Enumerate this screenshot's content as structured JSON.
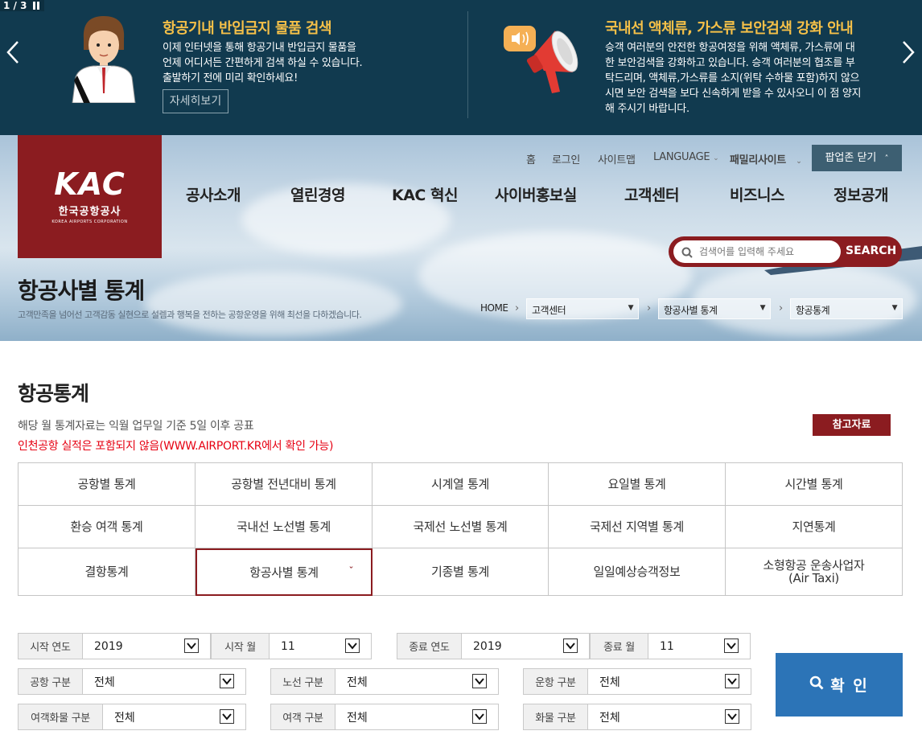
{
  "popup": {
    "counter": "1 / 3",
    "item1": {
      "title": "항공기내 반입금지 물품 검색",
      "line1": "이제 인터넷을 통해 항공기내 반입금지 물품을",
      "line2": "언제 어디서든 간편하게 검색 하실 수 있습니다.",
      "line3": "출발하기 전에 미리 확인하세요!",
      "button": "자세히보기"
    },
    "item2": {
      "title": "국내선 액체류, 가스류 보안검색 강화 안내",
      "line1": "승객 여러분의 안전한 항공여정을 위해 액체류, 가스류에 대",
      "line2": "한 보안검색을 강화하고 있습니다. 승객 여러분의 협조를 부",
      "line3": "탁드리며, 액체류,가스류를 소지(위탁 수하물 포함)하지 않으",
      "line4": "시면 보안 검색을 보다 신속하게 받을 수 있사오니 이 점 양지",
      "line5": "해 주시기 바랍니다."
    }
  },
  "header": {
    "logo": {
      "main": "KAC",
      "kr": "한국공항공사",
      "en": "KOREA AIRPORTS CORPORATION"
    },
    "util": {
      "home": "홈",
      "login": "로그인",
      "sitemap": "사이트맵",
      "language": "LANGUAGE",
      "family": "패밀리사이트",
      "popup_close": "팝업존 닫기"
    },
    "gnb": [
      "공사소개",
      "열린경영",
      "KAC 혁신",
      "사이버홍보실",
      "고객센터",
      "비즈니스",
      "정보공개"
    ],
    "search": {
      "placeholder": "검색어를 입력해 주세요",
      "button": "SEARCH"
    },
    "page_title": "항공사별 통계",
    "page_sub": "고객만족을 넘어선 고객감동 실현으로 설렘과 행복을 전하는 공항운영을 위해 최선을 다하겠습니다.",
    "breadcrumb": {
      "home": "HOME",
      "level1": "고객센터",
      "level2": "항공사별 통계",
      "level3": "항공통계"
    }
  },
  "content": {
    "title": "항공통계",
    "note1": "해당 월 통계자료는 익월 업무일 기준 5일 이후 공표",
    "note2": "인천공항 실적은 포함되지 않음(WWW.AIRPORT.KR에서 확인 가능)",
    "ref_button": "참고자료",
    "menu": [
      [
        "공항별 통계",
        "공항별 전년대비 통계",
        "시계열 통계",
        "요일별 통계",
        "시간별 통계"
      ],
      [
        "환승 여객 통계",
        "국내선 노선별 통계",
        "국제선 노선별 통계",
        "국제선 지역별 통계",
        "지연통계"
      ],
      [
        "결항통계",
        "항공사별 통계",
        "기종별 통계",
        "일일예상승객정보",
        "소형항공 운송사업자",
        "(Air Taxi)"
      ]
    ],
    "filters": {
      "start_year": {
        "label": "시작 연도",
        "value": "2019"
      },
      "start_month": {
        "label": "시작 월",
        "value": "11"
      },
      "end_year": {
        "label": "종료 연도",
        "value": "2019"
      },
      "end_month": {
        "label": "종료 월",
        "value": "11"
      },
      "airport": {
        "label": "공항 구분",
        "value": "전체"
      },
      "route": {
        "label": "노선 구분",
        "value": "전체"
      },
      "flight": {
        "label": "운항 구분",
        "value": "전체"
      },
      "pax_cargo": {
        "label": "여객화물 구분",
        "value": "전체"
      },
      "pax": {
        "label": "여객 구분",
        "value": "전체"
      },
      "cargo": {
        "label": "화물 구분",
        "value": "전체"
      }
    },
    "confirm": "확 인"
  }
}
